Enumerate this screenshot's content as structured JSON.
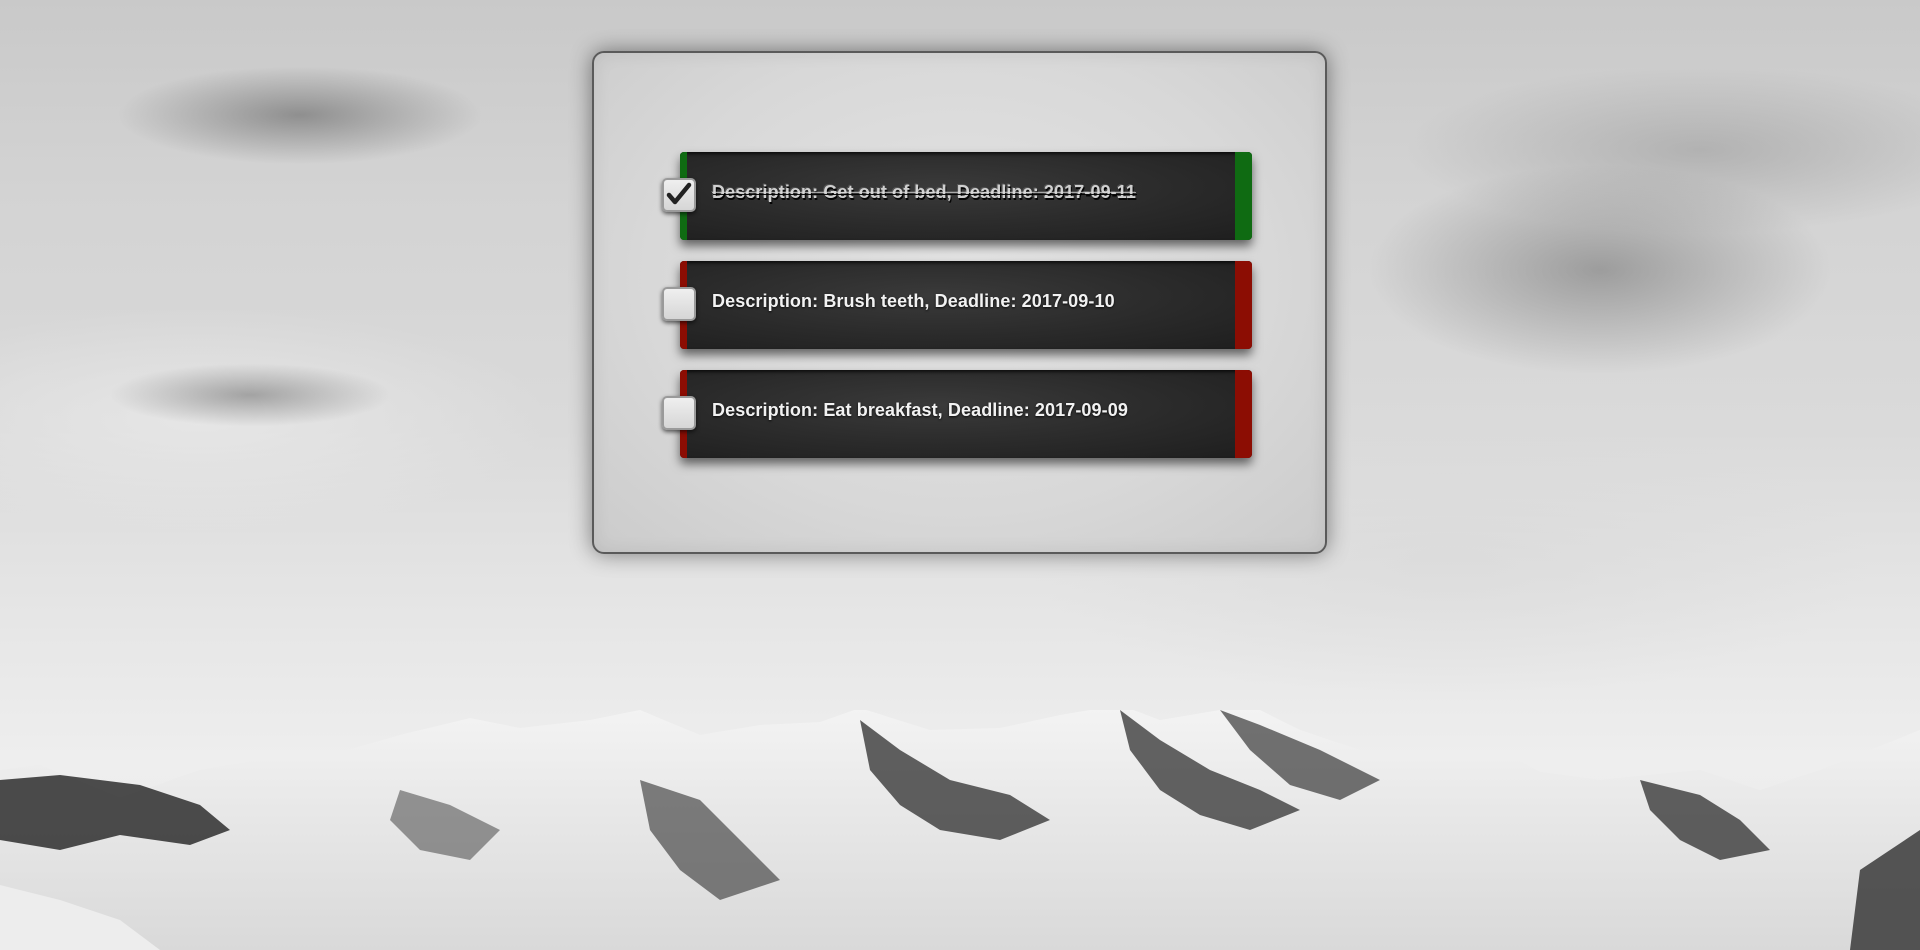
{
  "tasks": [
    {
      "text": "Description: Get out of bed, Deadline: 2017-09-11",
      "completed": true
    },
    {
      "text": "Description: Brush teeth, Deadline: 2017-09-10",
      "completed": false
    },
    {
      "text": "Description: Eat breakfast, Deadline: 2017-09-09",
      "completed": false
    }
  ],
  "colors": {
    "completed_accent": "#0f6b12",
    "pending_accent": "#8c0d03",
    "task_background": "#2a2a2a",
    "panel_background": "#d8d8d8"
  },
  "icons": {
    "checkmark": "check-icon"
  }
}
